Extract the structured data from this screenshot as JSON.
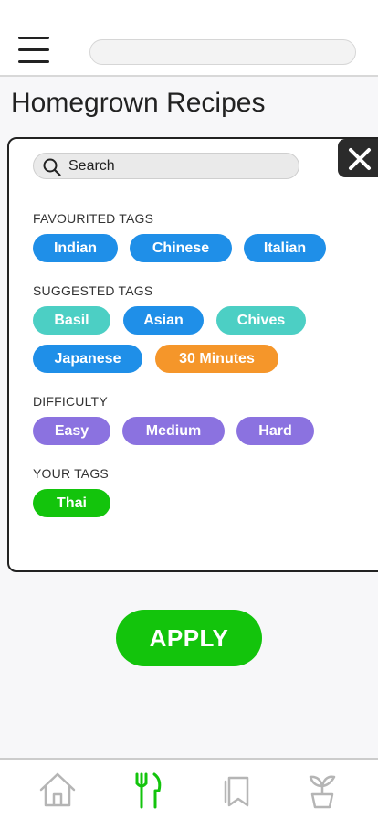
{
  "header": {
    "menu_icon": "hamburger-icon",
    "search_placeholder": ""
  },
  "page": {
    "title": "Homegrown Recipes"
  },
  "filter_panel": {
    "close_icon": "close-icon",
    "search": {
      "placeholder": "Search",
      "value": "",
      "icon": "search-icon"
    },
    "sections": {
      "favourited": {
        "label": "FAVOURITED TAGS",
        "tags": [
          {
            "label": "Indian",
            "color": "#1f8fe8"
          },
          {
            "label": "Chinese",
            "color": "#1f8fe8"
          },
          {
            "label": "Italian",
            "color": "#1f8fe8"
          }
        ]
      },
      "suggested": {
        "label": "SUGGESTED TAGS",
        "tags": [
          {
            "label": "Basil",
            "color": "#4ccfc4"
          },
          {
            "label": "Asian",
            "color": "#1f8fe8"
          },
          {
            "label": "Chives",
            "color": "#4ccfc4"
          },
          {
            "label": "Japanese",
            "color": "#1f8fe8"
          },
          {
            "label": "30 Minutes",
            "color": "#f5962a"
          }
        ]
      },
      "difficulty": {
        "label": "DIFFICULTY",
        "tags": [
          {
            "label": "Easy",
            "color": "#8b72e0"
          },
          {
            "label": "Medium",
            "color": "#8b72e0"
          },
          {
            "label": "Hard",
            "color": "#8b72e0"
          }
        ]
      },
      "your_tags": {
        "label": "YOUR TAGS",
        "tags": [
          {
            "label": "Thai",
            "color": "#13c40c"
          }
        ]
      }
    }
  },
  "apply_button": {
    "label": "APPLY",
    "color": "#13c40c"
  },
  "bottom_nav": {
    "items": [
      {
        "icon": "home-icon",
        "active": false
      },
      {
        "icon": "fork-knife-icon",
        "active": true
      },
      {
        "icon": "bookmark-icon",
        "active": false
      },
      {
        "icon": "plant-icon",
        "active": false
      }
    ],
    "active_color": "#13c40c",
    "inactive_color": "#b5b5b5"
  }
}
